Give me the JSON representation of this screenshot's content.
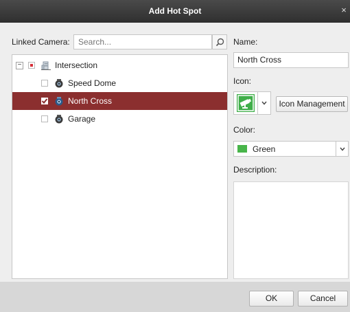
{
  "window": {
    "title": "Add Hot Spot",
    "close_glyph": "×"
  },
  "left": {
    "linked_camera_label": "Linked Camera:",
    "search": {
      "placeholder": "Search...",
      "value": ""
    },
    "tree": {
      "root": {
        "label": "Intersection",
        "icon": "building-icon",
        "state": "partial"
      },
      "cameras": [
        {
          "label": "Speed Dome",
          "icon": "camera-icon",
          "checked": false,
          "selected": false
        },
        {
          "label": "North Cross",
          "icon": "camera-icon",
          "checked": true,
          "selected": true
        },
        {
          "label": "Garage",
          "icon": "camera-icon",
          "checked": false,
          "selected": false
        }
      ]
    }
  },
  "right": {
    "name_label": "Name:",
    "name_value": "North Cross",
    "icon_label": "Icon:",
    "icon_selected": "hotspot-camera-icon",
    "icon_management_label": "Icon Management",
    "color_label": "Color:",
    "color": {
      "name": "Green",
      "hex": "#48b54a"
    },
    "description_label": "Description:",
    "description_value": ""
  },
  "footer": {
    "ok_label": "OK",
    "cancel_label": "Cancel"
  },
  "colors": {
    "selection": "#8b2f2f",
    "titlebar": "#3a3a3a",
    "partial_check": "#d6303a"
  }
}
